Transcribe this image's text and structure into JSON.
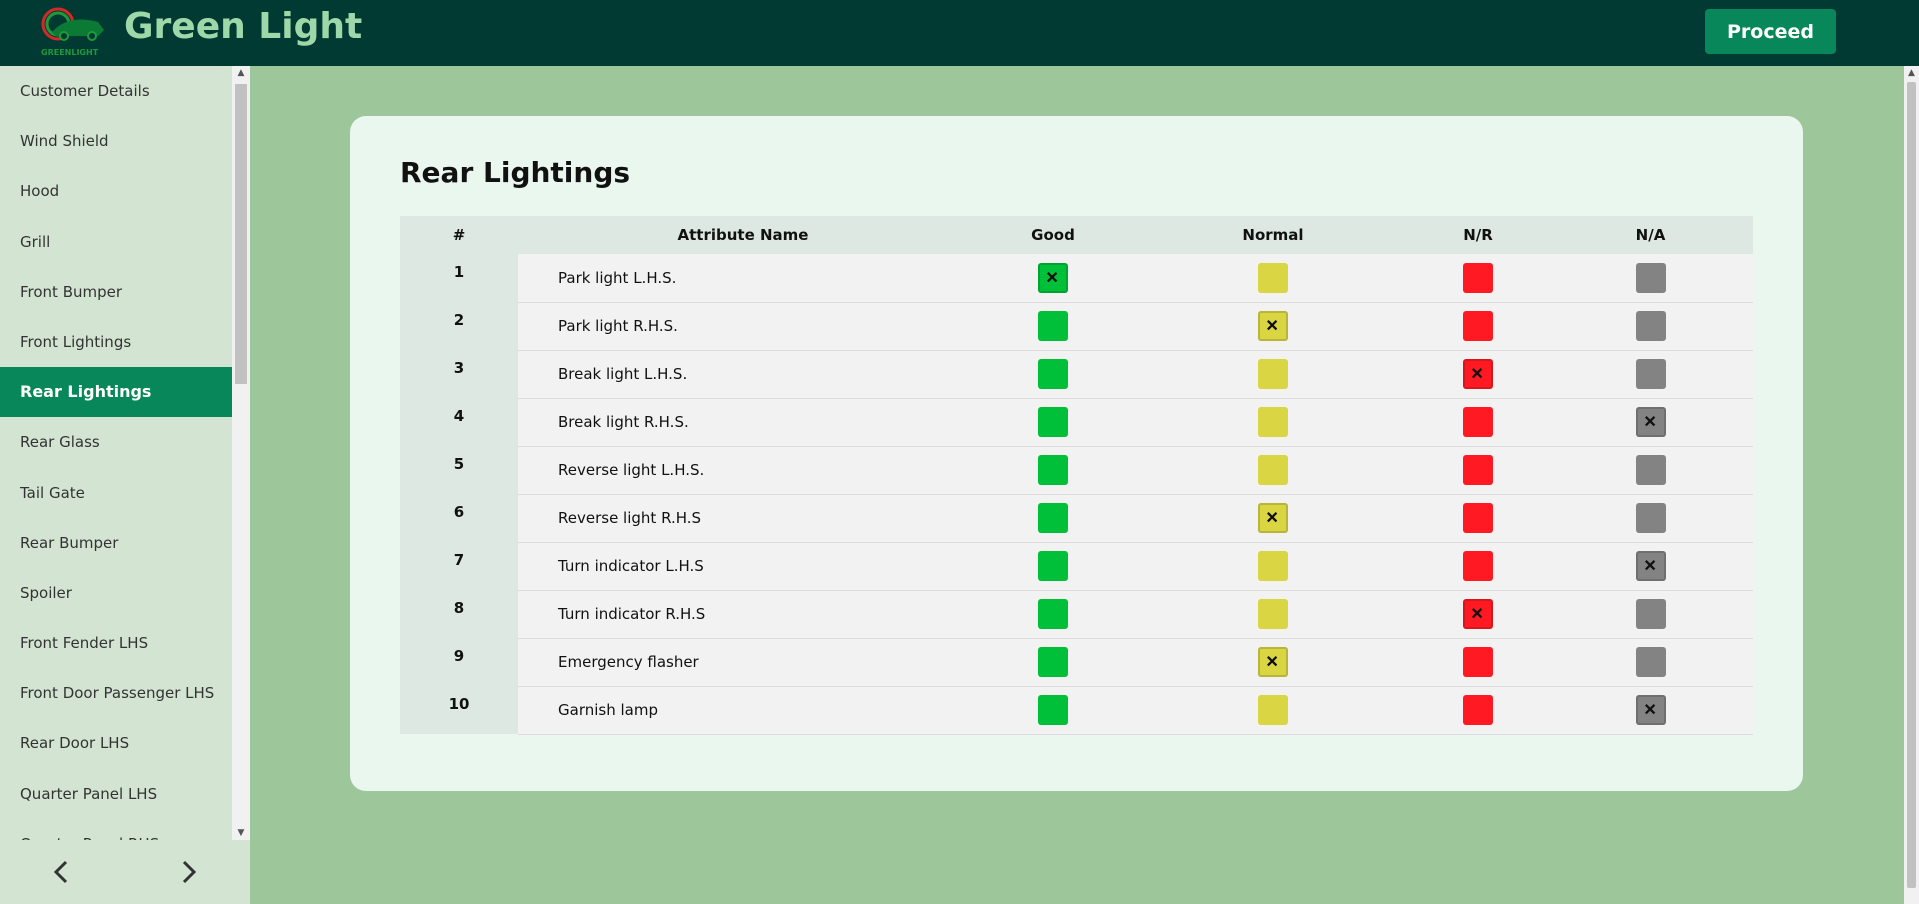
{
  "colors": {
    "header_bg": "#013a33",
    "accent": "#08875a",
    "good": "#00c03a",
    "normal": "#dad542",
    "nr": "#ff1a23",
    "na": "#838383"
  },
  "header": {
    "logo_text": "GREENLIGHT",
    "title": "Green Light",
    "proceed_label": "Proceed"
  },
  "sidebar": {
    "items": [
      {
        "label": "Customer Details"
      },
      {
        "label": "Wind Shield"
      },
      {
        "label": "Hood"
      },
      {
        "label": "Grill"
      },
      {
        "label": "Front Bumper"
      },
      {
        "label": "Front Lightings"
      },
      {
        "label": "Rear Lightings",
        "active": true
      },
      {
        "label": "Rear Glass"
      },
      {
        "label": "Tail Gate"
      },
      {
        "label": "Rear Bumper"
      },
      {
        "label": "Spoiler"
      },
      {
        "label": "Front Fender LHS"
      },
      {
        "label": "Front Door Passenger LHS"
      },
      {
        "label": "Rear Door LHS"
      },
      {
        "label": "Quarter Panel LHS"
      },
      {
        "label": "Quarter Panel RHS"
      }
    ],
    "prev_icon": "chevron-left-icon",
    "next_icon": "chevron-right-icon"
  },
  "main": {
    "title": "Rear Lightings",
    "columns": {
      "num": "#",
      "attr": "Attribute Name",
      "good": "Good",
      "normal": "Normal",
      "nr": "N/R",
      "na": "N/A"
    },
    "rows": [
      {
        "num": "1",
        "name": "Park light L.H.S.",
        "selected": "good"
      },
      {
        "num": "2",
        "name": "Park light R.H.S.",
        "selected": "normal"
      },
      {
        "num": "3",
        "name": "Break light L.H.S.",
        "selected": "nr"
      },
      {
        "num": "4",
        "name": "Break light R.H.S.",
        "selected": "na"
      },
      {
        "num": "5",
        "name": "Reverse light L.H.S.",
        "selected": ""
      },
      {
        "num": "6",
        "name": "Reverse light R.H.S",
        "selected": "normal"
      },
      {
        "num": "7",
        "name": "Turn indicator L.H.S",
        "selected": "na"
      },
      {
        "num": "8",
        "name": "Turn indicator R.H.S",
        "selected": "nr"
      },
      {
        "num": "9",
        "name": "Emergency flasher",
        "selected": "normal"
      },
      {
        "num": "10",
        "name": "Garnish lamp",
        "selected": "na"
      }
    ]
  }
}
